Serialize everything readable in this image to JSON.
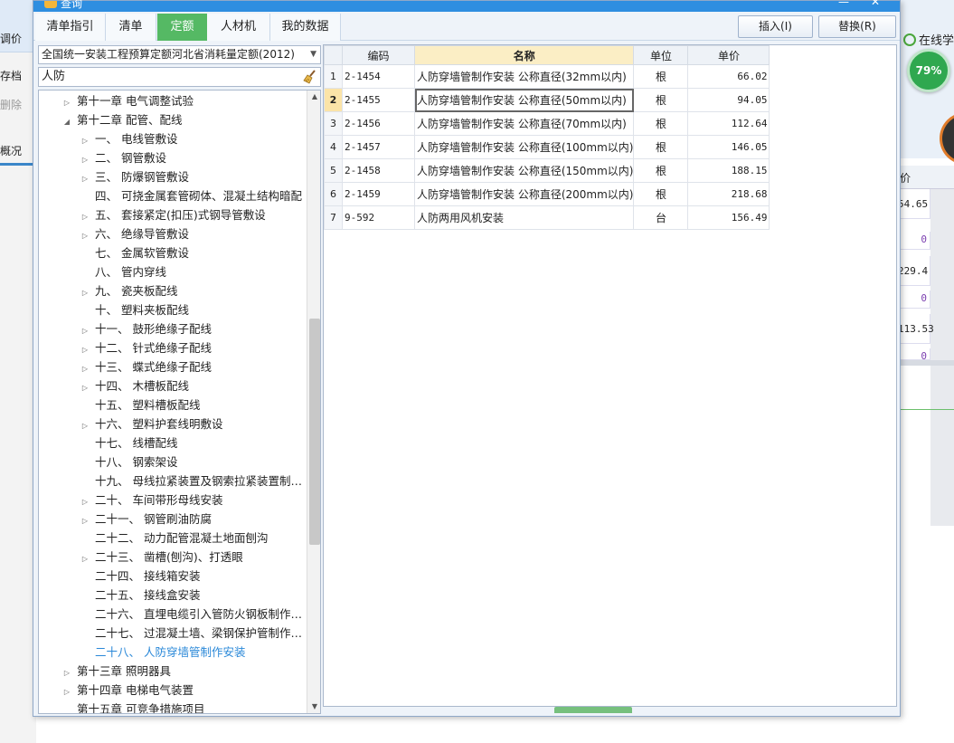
{
  "background": {
    "left_labels": [
      "调价",
      "存档",
      "删除",
      "概况"
    ],
    "online_label": "在线学",
    "progress_percent": "79%",
    "grid_header": "价",
    "grid_values": [
      "54.65",
      "0",
      "229.4",
      "0",
      "113.53",
      "0"
    ]
  },
  "dialog": {
    "title": "查询",
    "minimize_glyph": "—",
    "close_glyph": "✕",
    "tabs": [
      {
        "label": "清单指引"
      },
      {
        "label": "清单"
      },
      {
        "label": "定额",
        "active": true
      },
      {
        "label": "人材机"
      },
      {
        "label": "我的数据"
      }
    ],
    "buttons": {
      "insert": "插入(I)",
      "replace": "替换(R)"
    }
  },
  "left_panel": {
    "norm_select_value": "全国统一安装工程预算定额河北省消耗量定额(2012)",
    "search_value": "人防",
    "tree": [
      {
        "label": "第十一章 电气调整试验",
        "level": 1,
        "toggle": "collapsed"
      },
      {
        "label": "第十二章 配管、配线",
        "level": 1,
        "toggle": "expanded"
      },
      {
        "label": "一、 电线管敷设",
        "level": 2,
        "toggle": "collapsed"
      },
      {
        "label": "二、 钢管敷设",
        "level": 2,
        "toggle": "collapsed"
      },
      {
        "label": "三、 防爆钢管敷设",
        "level": 2,
        "toggle": "collapsed"
      },
      {
        "label": "四、 可挠金属套管砌体、混凝土结构暗配",
        "level": 2,
        "toggle": "none"
      },
      {
        "label": "五、 套接紧定(扣压)式钢导管敷设",
        "level": 2,
        "toggle": "collapsed"
      },
      {
        "label": "六、 绝缘导管敷设",
        "level": 2,
        "toggle": "collapsed"
      },
      {
        "label": "七、 金属软管敷设",
        "level": 2,
        "toggle": "none"
      },
      {
        "label": "八、 管内穿线",
        "level": 2,
        "toggle": "none"
      },
      {
        "label": "九、 瓷夹板配线",
        "level": 2,
        "toggle": "collapsed"
      },
      {
        "label": "十、 塑料夹板配线",
        "level": 2,
        "toggle": "none"
      },
      {
        "label": "十一、 鼓形绝缘子配线",
        "level": 2,
        "toggle": "collapsed"
      },
      {
        "label": "十二、 针式绝缘子配线",
        "level": 2,
        "toggle": "collapsed"
      },
      {
        "label": "十三、 蝶式绝缘子配线",
        "level": 2,
        "toggle": "collapsed"
      },
      {
        "label": "十四、 木槽板配线",
        "level": 2,
        "toggle": "collapsed"
      },
      {
        "label": "十五、 塑料槽板配线",
        "level": 2,
        "toggle": "none"
      },
      {
        "label": "十六、 塑料护套线明敷设",
        "level": 2,
        "toggle": "collapsed"
      },
      {
        "label": "十七、 线槽配线",
        "level": 2,
        "toggle": "none"
      },
      {
        "label": "十八、 钢索架设",
        "level": 2,
        "toggle": "none"
      },
      {
        "label": "十九、 母线拉紧装置及钢索拉紧装置制…",
        "level": 2,
        "toggle": "none"
      },
      {
        "label": "二十、 车间带形母线安装",
        "level": 2,
        "toggle": "collapsed"
      },
      {
        "label": "二十一、 钢管刷油防腐",
        "level": 2,
        "toggle": "collapsed"
      },
      {
        "label": "二十二、 动力配管混凝土地面刨沟",
        "level": 2,
        "toggle": "none"
      },
      {
        "label": "二十三、 凿槽(刨沟)、打透眼",
        "level": 2,
        "toggle": "collapsed"
      },
      {
        "label": "二十四、 接线箱安装",
        "level": 2,
        "toggle": "none"
      },
      {
        "label": "二十五、 接线盒安装",
        "level": 2,
        "toggle": "none"
      },
      {
        "label": "二十六、 直埋电缆引入管防火钢板制作…",
        "level": 2,
        "toggle": "none"
      },
      {
        "label": "二十七、 过混凝土墙、梁钢保护管制作…",
        "level": 2,
        "toggle": "none"
      },
      {
        "label": "二十八、 人防穿墙管制作安装",
        "level": 2,
        "toggle": "none",
        "selected": true
      },
      {
        "label": "第十三章 照明器具",
        "level": 1,
        "toggle": "collapsed"
      },
      {
        "label": "第十四章 电梯电气装置",
        "level": 1,
        "toggle": "collapsed"
      },
      {
        "label": "第十五章 可竞争措施项目",
        "level": 1,
        "toggle": "none"
      }
    ]
  },
  "grid": {
    "columns": [
      "",
      "编码",
      "名称",
      "单位",
      "单价"
    ],
    "current_row": 2,
    "rows": [
      {
        "idx": "1",
        "code": "2-1454",
        "name": "人防穿墙管制作安装 公称直径(32mm以内)",
        "unit": "根",
        "price": "66.02"
      },
      {
        "idx": "2",
        "code": "2-1455",
        "name": "人防穿墙管制作安装 公称直径(50mm以内)",
        "unit": "根",
        "price": "94.05"
      },
      {
        "idx": "3",
        "code": "2-1456",
        "name": "人防穿墙管制作安装 公称直径(70mm以内)",
        "unit": "根",
        "price": "112.64"
      },
      {
        "idx": "4",
        "code": "2-1457",
        "name": "人防穿墙管制作安装 公称直径(100mm以内)",
        "unit": "根",
        "price": "146.05"
      },
      {
        "idx": "5",
        "code": "2-1458",
        "name": "人防穿墙管制作安装 公称直径(150mm以内)",
        "unit": "根",
        "price": "188.15"
      },
      {
        "idx": "6",
        "code": "2-1459",
        "name": "人防穿墙管制作安装 公称直径(200mm以内)",
        "unit": "根",
        "price": "218.68"
      },
      {
        "idx": "7",
        "code": "9-592",
        "name": "人防两用风机安装",
        "unit": "台",
        "price": "156.49"
      }
    ]
  },
  "colors": {
    "accent_green": "#55b964",
    "title_blue": "#2e8ee0",
    "selected_tree_text": "#2a88d8",
    "header_highlight": "#fbeec5"
  }
}
